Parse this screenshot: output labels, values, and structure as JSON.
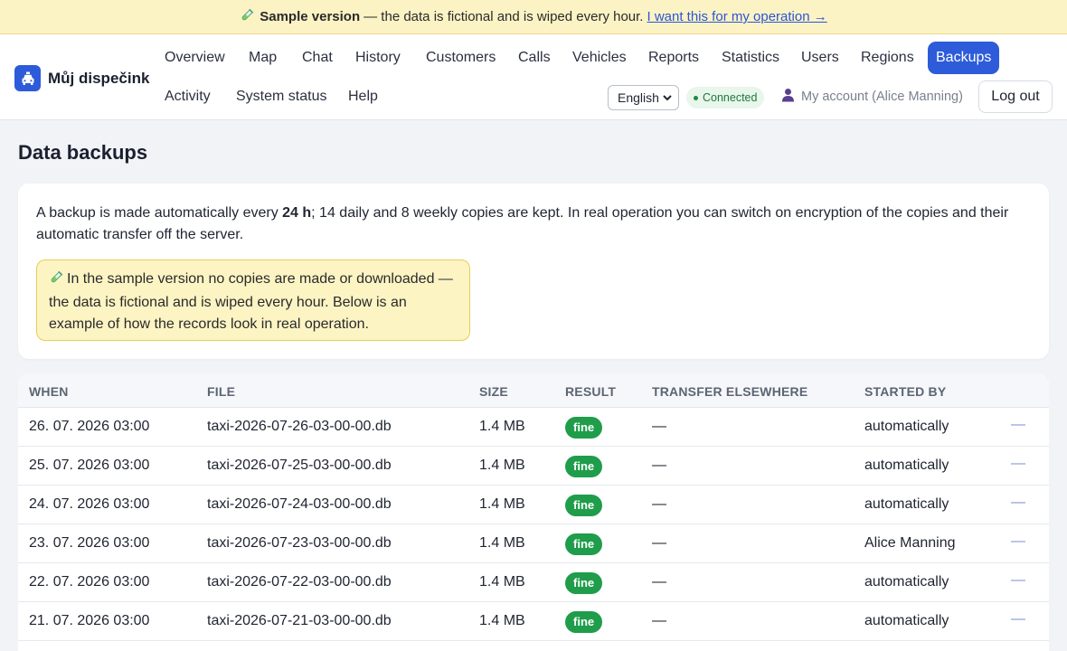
{
  "banner": {
    "bold": "Sample version",
    "text": "— the data is fictional and is wiped every hour.",
    "link": "I want this for my operation →"
  },
  "brand": {
    "name": "Můj dispečink"
  },
  "nav": {
    "row1": [
      "Overview",
      "Map",
      "Chat",
      "History",
      "Customers",
      "Calls",
      "Vehicles",
      "Reports",
      "Statistics",
      "Users",
      "Regions",
      "Backups"
    ],
    "row2": [
      "Activity",
      "System status",
      "Help"
    ],
    "active": "Backups"
  },
  "header": {
    "language": "English",
    "status": "Connected",
    "account": "My account (Alice Manning)",
    "logout": "Log out"
  },
  "page": {
    "title": "Data backups",
    "info_before": "A backup is made automatically every ",
    "info_bold": "24 h",
    "info_after": "; 14 daily and 8 weekly copies are kept. In real operation you can switch on encryption of the copies and their automatic transfer off the server.",
    "sample_note": "In the sample version no copies are made or downloaded — the data is fictional and is wiped every hour. Below is an example of how the records look in real operation."
  },
  "table": {
    "headers": [
      "WHEN",
      "FILE",
      "SIZE",
      "RESULT",
      "TRANSFER ELSEWHERE",
      "STARTED BY"
    ],
    "rows": [
      {
        "when": "26. 07. 2026 03:00",
        "file": "taxi-2026-07-26-03-00-00.db",
        "size": "1.4 MB",
        "result": "fine",
        "transfer": "—",
        "started_by": "automatically",
        "action": "—"
      },
      {
        "when": "25. 07. 2026 03:00",
        "file": "taxi-2026-07-25-03-00-00.db",
        "size": "1.4 MB",
        "result": "fine",
        "transfer": "—",
        "started_by": "automatically",
        "action": "—"
      },
      {
        "when": "24. 07. 2026 03:00",
        "file": "taxi-2026-07-24-03-00-00.db",
        "size": "1.4 MB",
        "result": "fine",
        "transfer": "—",
        "started_by": "automatically",
        "action": "—"
      },
      {
        "when": "23. 07. 2026 03:00",
        "file": "taxi-2026-07-23-03-00-00.db",
        "size": "1.4 MB",
        "result": "fine",
        "transfer": "—",
        "started_by": "Alice Manning",
        "action": "—"
      },
      {
        "when": "22. 07. 2026 03:00",
        "file": "taxi-2026-07-22-03-00-00.db",
        "size": "1.4 MB",
        "result": "fine",
        "transfer": "—",
        "started_by": "automatically",
        "action": "—"
      },
      {
        "when": "21. 07. 2026 03:00",
        "file": "taxi-2026-07-21-03-00-00.db",
        "size": "1.4 MB",
        "result": "fine",
        "transfer": "—",
        "started_by": "automatically",
        "action": "—"
      }
    ]
  },
  "icons": {
    "brand": "taxi-icon",
    "banner": "test-tube-icon",
    "account": "person-icon",
    "status": "status-dot-icon"
  },
  "colors": {
    "accent": "#2d5bd9",
    "banner_bg": "#fcf3c4",
    "success": "#1f9d4b"
  }
}
